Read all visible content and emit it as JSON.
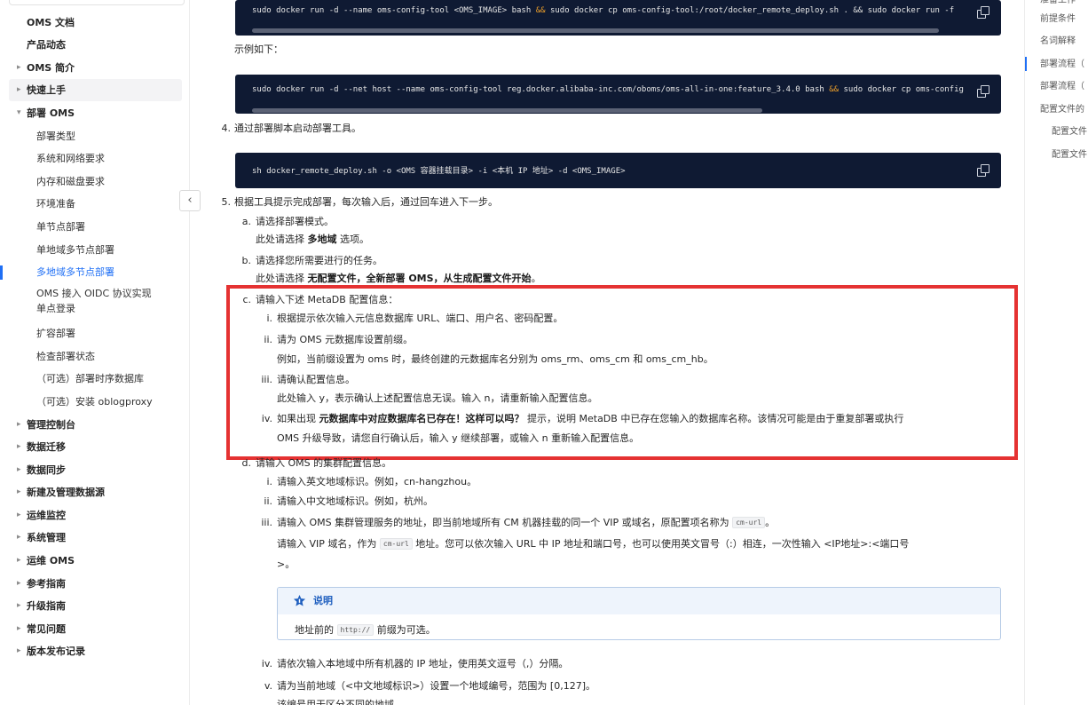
{
  "sidebar": {
    "items": [
      {
        "label": "OMS 文档",
        "level": 0
      },
      {
        "label": "产品动态",
        "level": 0
      },
      {
        "label": "OMS 简介",
        "level": 0,
        "caret": "▸"
      },
      {
        "label": "快速上手",
        "level": 0,
        "caret": "▸"
      },
      {
        "label": "部署 OMS",
        "level": 0,
        "caret": "▾"
      },
      {
        "label": "部署类型",
        "level": 1
      },
      {
        "label": "系统和网络要求",
        "level": 1
      },
      {
        "label": "内存和磁盘要求",
        "level": 1
      },
      {
        "label": "环境准备",
        "level": 1
      },
      {
        "label": "单节点部署",
        "level": 1
      },
      {
        "label": "单地域多节点部署",
        "level": 1
      },
      {
        "label": "多地域多节点部署",
        "level": 1
      },
      {
        "label": "OMS 接入 OIDC 协议实现单点登录",
        "level": 1
      },
      {
        "label": "扩容部署",
        "level": 1
      },
      {
        "label": "检查部署状态",
        "level": 1
      },
      {
        "label": "（可选）部署时序数据库",
        "level": 1
      },
      {
        "label": "（可选）安装 oblogproxy",
        "level": 1
      },
      {
        "label": "管理控制台",
        "level": 0,
        "caret": "▸"
      },
      {
        "label": "数据迁移",
        "level": 0,
        "caret": "▸"
      },
      {
        "label": "数据同步",
        "level": 0,
        "caret": "▸"
      },
      {
        "label": "新建及管理数据源",
        "level": 0,
        "caret": "▸"
      },
      {
        "label": "运维监控",
        "level": 0,
        "caret": "▸"
      },
      {
        "label": "系统管理",
        "level": 0,
        "caret": "▸"
      },
      {
        "label": "运维 OMS",
        "level": 0,
        "caret": "▸"
      },
      {
        "label": "参考指南",
        "level": 0,
        "caret": "▸"
      },
      {
        "label": "升级指南",
        "level": 0,
        "caret": "▸"
      },
      {
        "label": "常见问题",
        "level": 0,
        "caret": "▸"
      },
      {
        "label": "版本发布记录",
        "level": 0,
        "caret": "▸"
      }
    ],
    "collapse_glyph": "‹"
  },
  "content": {
    "code1": {
      "pre": "sudo docker run -d --name oms-config-tool <OMS_IMAGE> bash ",
      "op": "&&",
      "post": " sudo docker cp oms-config-tool:/root/docker_remote_deploy.sh . && sudo docker run -f"
    },
    "example_label": "示例如下：",
    "code2": {
      "pre": "sudo docker run -d --net host --name oms-config-tool reg.docker.alibaba-inc.com/oboms/oms-all-in-one:feature_3.4.0 bash ",
      "op": "&&",
      "post": " sudo docker cp oms-config"
    },
    "step4_num": "4.",
    "step4": "通过部署脚本启动部署工具。",
    "code3": "sh docker_remote_deploy.sh -o <OMS 容器挂载目录> -i <本机 IP 地址> -d <OMS_IMAGE>",
    "step5_num": "5.",
    "step5": "根据工具提示完成部署，每次输入后，通过回车进入下一步。",
    "a_num": "a.",
    "a_title": "请选择部署模式。",
    "a_desc_pre": "此处请选择 ",
    "a_desc_bold": "多地域",
    "a_desc_post": " 选项。",
    "b_num": "b.",
    "b_title": "请选择您所需要进行的任务。",
    "b_desc_pre": "此处请选择 ",
    "b_desc_bold": "无配置文件，全新部署 OMS，从生成配置文件开始",
    "b_desc_post": "。",
    "c_num": "c.",
    "c_title": "请输入下述 MetaDB 配置信息：",
    "c_i_num": "i.",
    "c_i": "根据提示依次输入元信息数据库 URL、端口、用户名、密码配置。",
    "c_ii_num": "ii.",
    "c_ii": "请为 OMS 元数据库设置前缀。",
    "c_ii_desc": "例如，当前缀设置为 oms 时，最终创建的元数据库名分别为 oms_rm、oms_cm 和 oms_cm_hb。",
    "c_iii_num": "iii.",
    "c_iii": "请确认配置信息。",
    "c_iii_desc": "此处输入 y，表示确认上述配置信息无误。输入 n，请重新输入配置信息。",
    "c_iv_num": "iv.",
    "c_iv_pre": "如果出现 ",
    "c_iv_bold": "元数据库中对应数据库名已存在！这样可以吗？",
    "c_iv_post": " 提示，说明 MetaDB 中已存在您输入的数据库名称。该情况可能是由于重复部署或执行",
    "c_iv_line2": "OMS 升级导致，请您自行确认后，输入 y 继续部署，或输入 n 重新输入配置信息。",
    "d_num": "d.",
    "d_title": "请输入 OMS 的集群配置信息。",
    "d_i_num": "i.",
    "d_i": "请输入英文地域标识。例如，cn-hangzhou。",
    "d_ii_num": "ii.",
    "d_ii": "请输入中文地域标识。例如，杭州。",
    "d_iii_num": "iii.",
    "d_iii_pre": "请输入 OMS 集群管理服务的地址，即当前地域所有 CM 机器挂载的同一个 VIP 或域名，原配置项名称为 ",
    "d_iii_code": "cm-url",
    "d_iii_post": "。",
    "d_iii_l2_pre": "请输入 VIP 域名，作为 ",
    "d_iii_l2_code": "cm-url",
    "d_iii_l2_post": " 地址。您可以依次输入 URL 中 IP 地址和端口号，也可以使用英文冒号（:）相连，一次性输入 <IP地址>:<端口号",
    "d_iii_l3": ">。",
    "note_title": "说明",
    "note_pre": "地址前的 ",
    "note_code": "http://",
    "note_post": " 前缀为可选。",
    "d_iv_num": "iv.",
    "d_iv": "请依次输入本地域中所有机器的 IP 地址，使用英文逗号（,）分隔。",
    "d_v_num": "v.",
    "d_v": "请为当前地域（<中文地域标识>）设置一个地域编号，范围为 [0,127]。",
    "d_v_desc": "该编号用于区分不同的地域"
  },
  "toc": {
    "items": [
      {
        "label": "准备工作",
        "level": 0
      },
      {
        "label": "前提条件",
        "level": 0
      },
      {
        "label": "名词解释",
        "level": 0
      },
      {
        "label": "部署流程（",
        "level": 0,
        "active": true
      },
      {
        "label": "部署流程（",
        "level": 0
      },
      {
        "label": "配置文件的",
        "level": 0
      },
      {
        "label": "配置文件",
        "level": 1
      },
      {
        "label": "配置文件",
        "level": 1
      }
    ]
  },
  "colors": {
    "accent": "#1f6ff5",
    "highlight": "#e53232",
    "code_bg": "#0f1a33"
  }
}
